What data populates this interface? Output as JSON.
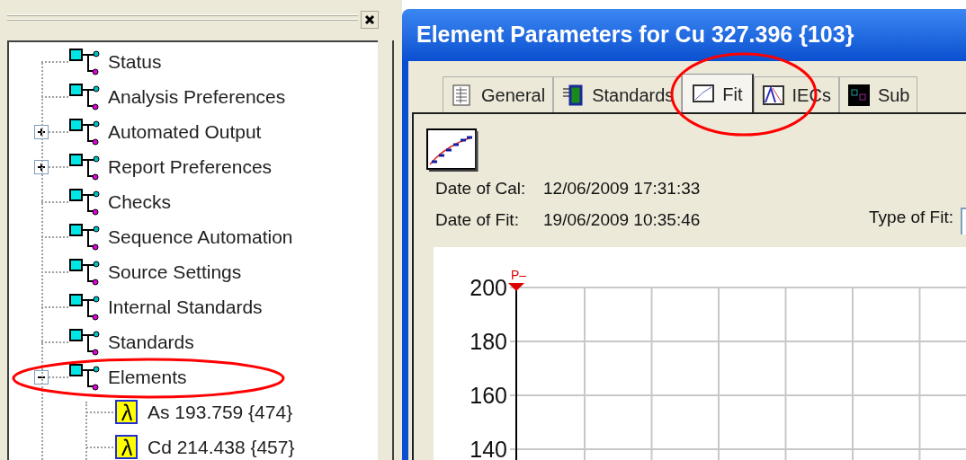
{
  "tree": {
    "items": [
      {
        "label": "Status",
        "kind": "setting"
      },
      {
        "label": "Analysis Preferences",
        "kind": "setting"
      },
      {
        "label": "Automated Output",
        "kind": "setting",
        "expanded": false
      },
      {
        "label": "Report Preferences",
        "kind": "setting",
        "expanded": false
      },
      {
        "label": "Checks",
        "kind": "setting"
      },
      {
        "label": "Sequence Automation",
        "kind": "setting"
      },
      {
        "label": "Source Settings",
        "kind": "setting"
      },
      {
        "label": "Internal Standards",
        "kind": "setting"
      },
      {
        "label": "Standards",
        "kind": "setting"
      },
      {
        "label": "Elements",
        "kind": "setting",
        "expanded": true,
        "children": [
          {
            "label": "As 193.759 {474}",
            "kind": "element"
          },
          {
            "label": "Cd 214.438 {457}",
            "kind": "element"
          }
        ]
      }
    ]
  },
  "window": {
    "title": "Element Parameters for Cu 327.396 {103}",
    "tabs": [
      {
        "label": "General",
        "kind": "general",
        "selected": false
      },
      {
        "label": "Standards",
        "kind": "standards",
        "selected": false
      },
      {
        "label": "Fit",
        "kind": "fit",
        "selected": true
      },
      {
        "label": "IECs",
        "kind": "iecs",
        "selected": false
      },
      {
        "label": "Sub",
        "kind": "suba",
        "selected": false
      }
    ],
    "fields": [
      {
        "label": "Date of Cal:",
        "value": "12/06/2009 17:31:33"
      },
      {
        "label": "Date of Fit:",
        "value": "19/06/2009 10:35:46"
      }
    ],
    "type_of_fit_label": "Type of Fit:",
    "plot": {
      "y_axis_labels": [
        "200",
        "180",
        "160",
        "140"
      ],
      "marker_label": "P–"
    }
  }
}
